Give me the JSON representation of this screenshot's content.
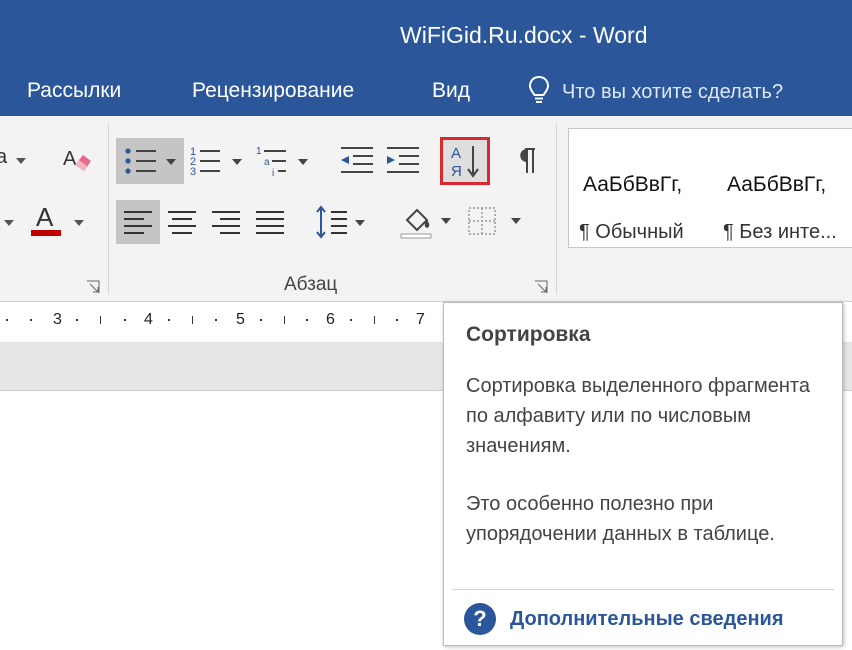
{
  "window": {
    "title": "WiFiGid.Ru.docx - Word"
  },
  "tabs": [
    "Рассылки",
    "Рецензирование",
    "Вид"
  ],
  "tellme": {
    "placeholder": "Что вы хотите сделать?",
    "icon": "lightbulb-icon"
  },
  "ribbon": {
    "paragraph_group_label": "Абзац",
    "partial_font_text": "a",
    "styles": [
      {
        "sample": "АаБбВвГг,",
        "name": "¶ Обычный"
      },
      {
        "sample": "АаБбВвГг,",
        "name": "¶ Без инте..."
      }
    ],
    "sort_button": {
      "glyph_top": "А",
      "glyph_bottom": "Я",
      "highlighted": true
    }
  },
  "ruler": {
    "numbers": [
      "3",
      "4",
      "5",
      "6",
      "7"
    ]
  },
  "tooltip": {
    "title": "Сортировка",
    "description": "Сортировка выделенного фрагмента по алфавиту или по числовым значениям.",
    "note": "Это особенно полезно при упорядочении данных в таблице.",
    "link": "Дополнительные сведения"
  },
  "colors": {
    "accent": "#2b579a",
    "highlight": "#d9282f",
    "font_color_bar": "#c00000"
  }
}
